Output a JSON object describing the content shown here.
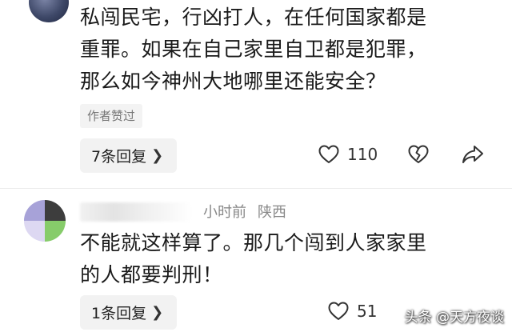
{
  "comments": [
    {
      "lines": [
        "私闯民宅，行凶打人，在任何国家都是",
        "重罪。如果在自己家里自卫都是犯罪，",
        "那么如今神州大地哪里还能安全？"
      ],
      "author_liked_label": "作者赞过",
      "reply_label": "7条回复",
      "like_count": "110"
    },
    {
      "time": "小时前",
      "location": "陕西",
      "lines": [
        "不能就这样算了。那几个闯到人家家里",
        "的人都要判刑！"
      ],
      "reply_label": "1条回复",
      "like_count": "51"
    }
  ],
  "icons": {
    "like": "heart-icon",
    "dislike": "broken-heart-icon",
    "share": "share-arrow-icon",
    "chevron": "chevron-right-icon"
  },
  "watermark": "头条 @天方夜谈"
}
